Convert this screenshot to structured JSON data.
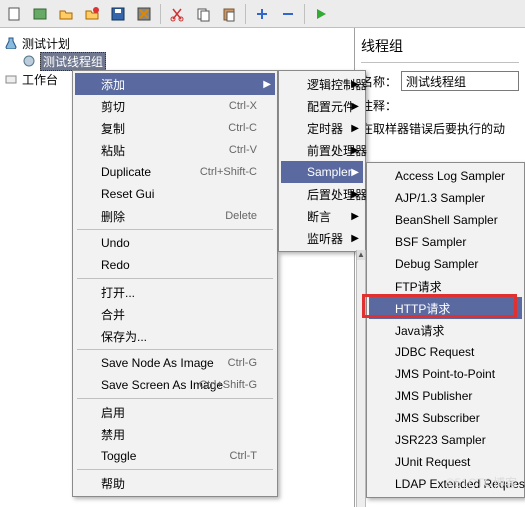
{
  "toolbar": {
    "icons": [
      "file",
      "template",
      "open",
      "close",
      "save",
      "save-all",
      "",
      "cut",
      "copy",
      "paste",
      "",
      "expand",
      "collapse",
      "",
      "run"
    ]
  },
  "tree": {
    "root": "测试计划",
    "threadgroup": "测试线程组",
    "workbench": "工作台"
  },
  "panel": {
    "title": "线程组",
    "name_label": "名称：",
    "name_value": "测试线程组",
    "comment_label": "注释：",
    "error_label": "在取样器错误后要执行的动"
  },
  "menu1": [
    {
      "label": "添加",
      "hl": true,
      "arrow": true
    },
    {
      "label": "剪切",
      "short": "Ctrl-X"
    },
    {
      "label": "复制",
      "short": "Ctrl-C"
    },
    {
      "label": "粘贴",
      "short": "Ctrl-V"
    },
    {
      "label": "Duplicate",
      "short": "Ctrl+Shift-C"
    },
    {
      "label": "Reset Gui"
    },
    {
      "label": "删除",
      "short": "Delete"
    },
    {
      "divider": true
    },
    {
      "label": "Undo"
    },
    {
      "label": "Redo"
    },
    {
      "divider": true
    },
    {
      "label": "打开..."
    },
    {
      "label": "合并"
    },
    {
      "label": "保存为..."
    },
    {
      "divider": true
    },
    {
      "label": "Save Node As Image",
      "short": "Ctrl-G"
    },
    {
      "label": "Save Screen As Image",
      "short": "Ctrl+Shift-G"
    },
    {
      "divider": true
    },
    {
      "label": "启用"
    },
    {
      "label": "禁用"
    },
    {
      "label": "Toggle",
      "short": "Ctrl-T"
    },
    {
      "divider": true
    },
    {
      "label": "帮助"
    }
  ],
  "menu2": [
    {
      "label": "逻辑控制器",
      "arrow": true
    },
    {
      "label": "配置元件",
      "arrow": true
    },
    {
      "label": "定时器",
      "arrow": true
    },
    {
      "label": "前置处理器",
      "arrow": true
    },
    {
      "label": "Sampler",
      "hl": true,
      "arrow": true
    },
    {
      "label": "后置处理器",
      "arrow": true
    },
    {
      "label": "断言",
      "arrow": true
    },
    {
      "label": "监听器",
      "arrow": true
    }
  ],
  "menu3": [
    {
      "label": "Access Log Sampler"
    },
    {
      "label": "AJP/1.3 Sampler"
    },
    {
      "label": "BeanShell Sampler"
    },
    {
      "label": "BSF Sampler"
    },
    {
      "label": "Debug Sampler"
    },
    {
      "label": "FTP请求"
    },
    {
      "label": "HTTP请求",
      "hl": true
    },
    {
      "label": "Java请求"
    },
    {
      "label": "JDBC Request"
    },
    {
      "label": "JMS Point-to-Point"
    },
    {
      "label": "JMS Publisher"
    },
    {
      "label": "JMS Subscriber"
    },
    {
      "label": "JSR223 Sampler"
    },
    {
      "label": "JUnit Request"
    },
    {
      "label": "LDAP Extended Request"
    }
  ],
  "watermark": "©51CTO博客"
}
